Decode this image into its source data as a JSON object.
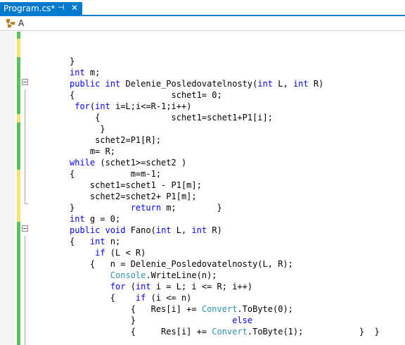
{
  "tab": {
    "title": "Program.cs*",
    "pin_glyph": "⊣",
    "close_glyph": "✕"
  },
  "navbar": {
    "class_label": "A"
  },
  "code_lines": [
    [
      {
        "t": "}"
      }
    ],
    [
      {
        "t": "int",
        "c": "kw"
      },
      {
        "t": " m;"
      }
    ],
    [
      {
        "t": "public",
        "c": "kw"
      },
      {
        "t": " "
      },
      {
        "t": "int",
        "c": "kw"
      },
      {
        "t": " Delenie_Posledovatelnosty("
      },
      {
        "t": "int",
        "c": "kw"
      },
      {
        "t": " L, "
      },
      {
        "t": "int",
        "c": "kw"
      },
      {
        "t": " R)"
      }
    ],
    [
      {
        "t": "{                   schet1= 0;"
      }
    ],
    [
      {
        "t": " "
      },
      {
        "t": "for",
        "c": "kw"
      },
      {
        "t": "("
      },
      {
        "t": "int",
        "c": "kw"
      },
      {
        "t": " i=L;i<=R-1;i++)"
      }
    ],
    [
      {
        "t": "     {              schet1=schet1+P1[i];"
      }
    ],
    [
      {
        "t": "      }"
      }
    ],
    [
      {
        "t": "     schet2=P1[R];"
      }
    ],
    [
      {
        "t": "    m= R;"
      }
    ],
    [
      {
        "t": "while",
        "c": "kw"
      },
      {
        "t": " (schet1>=schet2 )"
      }
    ],
    [
      {
        "t": "{           m=m-1;"
      }
    ],
    [
      {
        "t": "    schet1=schet1 - P1[m];"
      }
    ],
    [
      {
        "t": "    schet2=schet2+ P1[m];"
      }
    ],
    [
      {
        "t": "}           "
      },
      {
        "t": "return",
        "c": "kw"
      },
      {
        "t": " m;        }"
      }
    ],
    [
      {
        "t": "int",
        "c": "kw"
      },
      {
        "t": " g = 0;"
      }
    ],
    [
      {
        "t": "public",
        "c": "kw"
      },
      {
        "t": " "
      },
      {
        "t": "void",
        "c": "kw"
      },
      {
        "t": " Fano("
      },
      {
        "t": "int",
        "c": "kw"
      },
      {
        "t": " L, "
      },
      {
        "t": "int",
        "c": "kw"
      },
      {
        "t": " R)"
      }
    ],
    [
      {
        "t": "{   "
      },
      {
        "t": "int",
        "c": "kw"
      },
      {
        "t": " n;"
      }
    ],
    [
      {
        "t": "     "
      },
      {
        "t": "if",
        "c": "kw"
      },
      {
        "t": " (L < R)"
      }
    ],
    [
      {
        "t": "    {   n = Delenie_Posledovatelnosty(L, R);"
      }
    ],
    [
      {
        "t": "        "
      },
      {
        "t": "Console",
        "c": "ty"
      },
      {
        "t": ".WriteLine(n);"
      }
    ],
    [
      {
        "t": "        "
      },
      {
        "t": "for",
        "c": "kw"
      },
      {
        "t": " ("
      },
      {
        "t": "int",
        "c": "kw"
      },
      {
        "t": " i = L; i <= R; i++)"
      }
    ],
    [
      {
        "t": "        {    "
      },
      {
        "t": "if",
        "c": "kw"
      },
      {
        "t": " (i <= n)"
      }
    ],
    [
      {
        "t": "            {   Res[i] += "
      },
      {
        "t": "Convert",
        "c": "ty"
      },
      {
        "t": ".ToByte(0);"
      }
    ],
    [
      {
        "t": "            }                   "
      },
      {
        "t": "else",
        "c": "kw"
      }
    ],
    [
      {
        "t": "            {     Res[i] += "
      },
      {
        "t": "Convert",
        "c": "ty"
      },
      {
        "t": ".ToByte(1);           }  }"
      }
    ]
  ],
  "colors": {
    "tab_active": "#007acc",
    "change_saved": "#57c457",
    "change_unsaved": "#f6e275",
    "keyword": "#0000ff",
    "type": "#2b91af"
  }
}
